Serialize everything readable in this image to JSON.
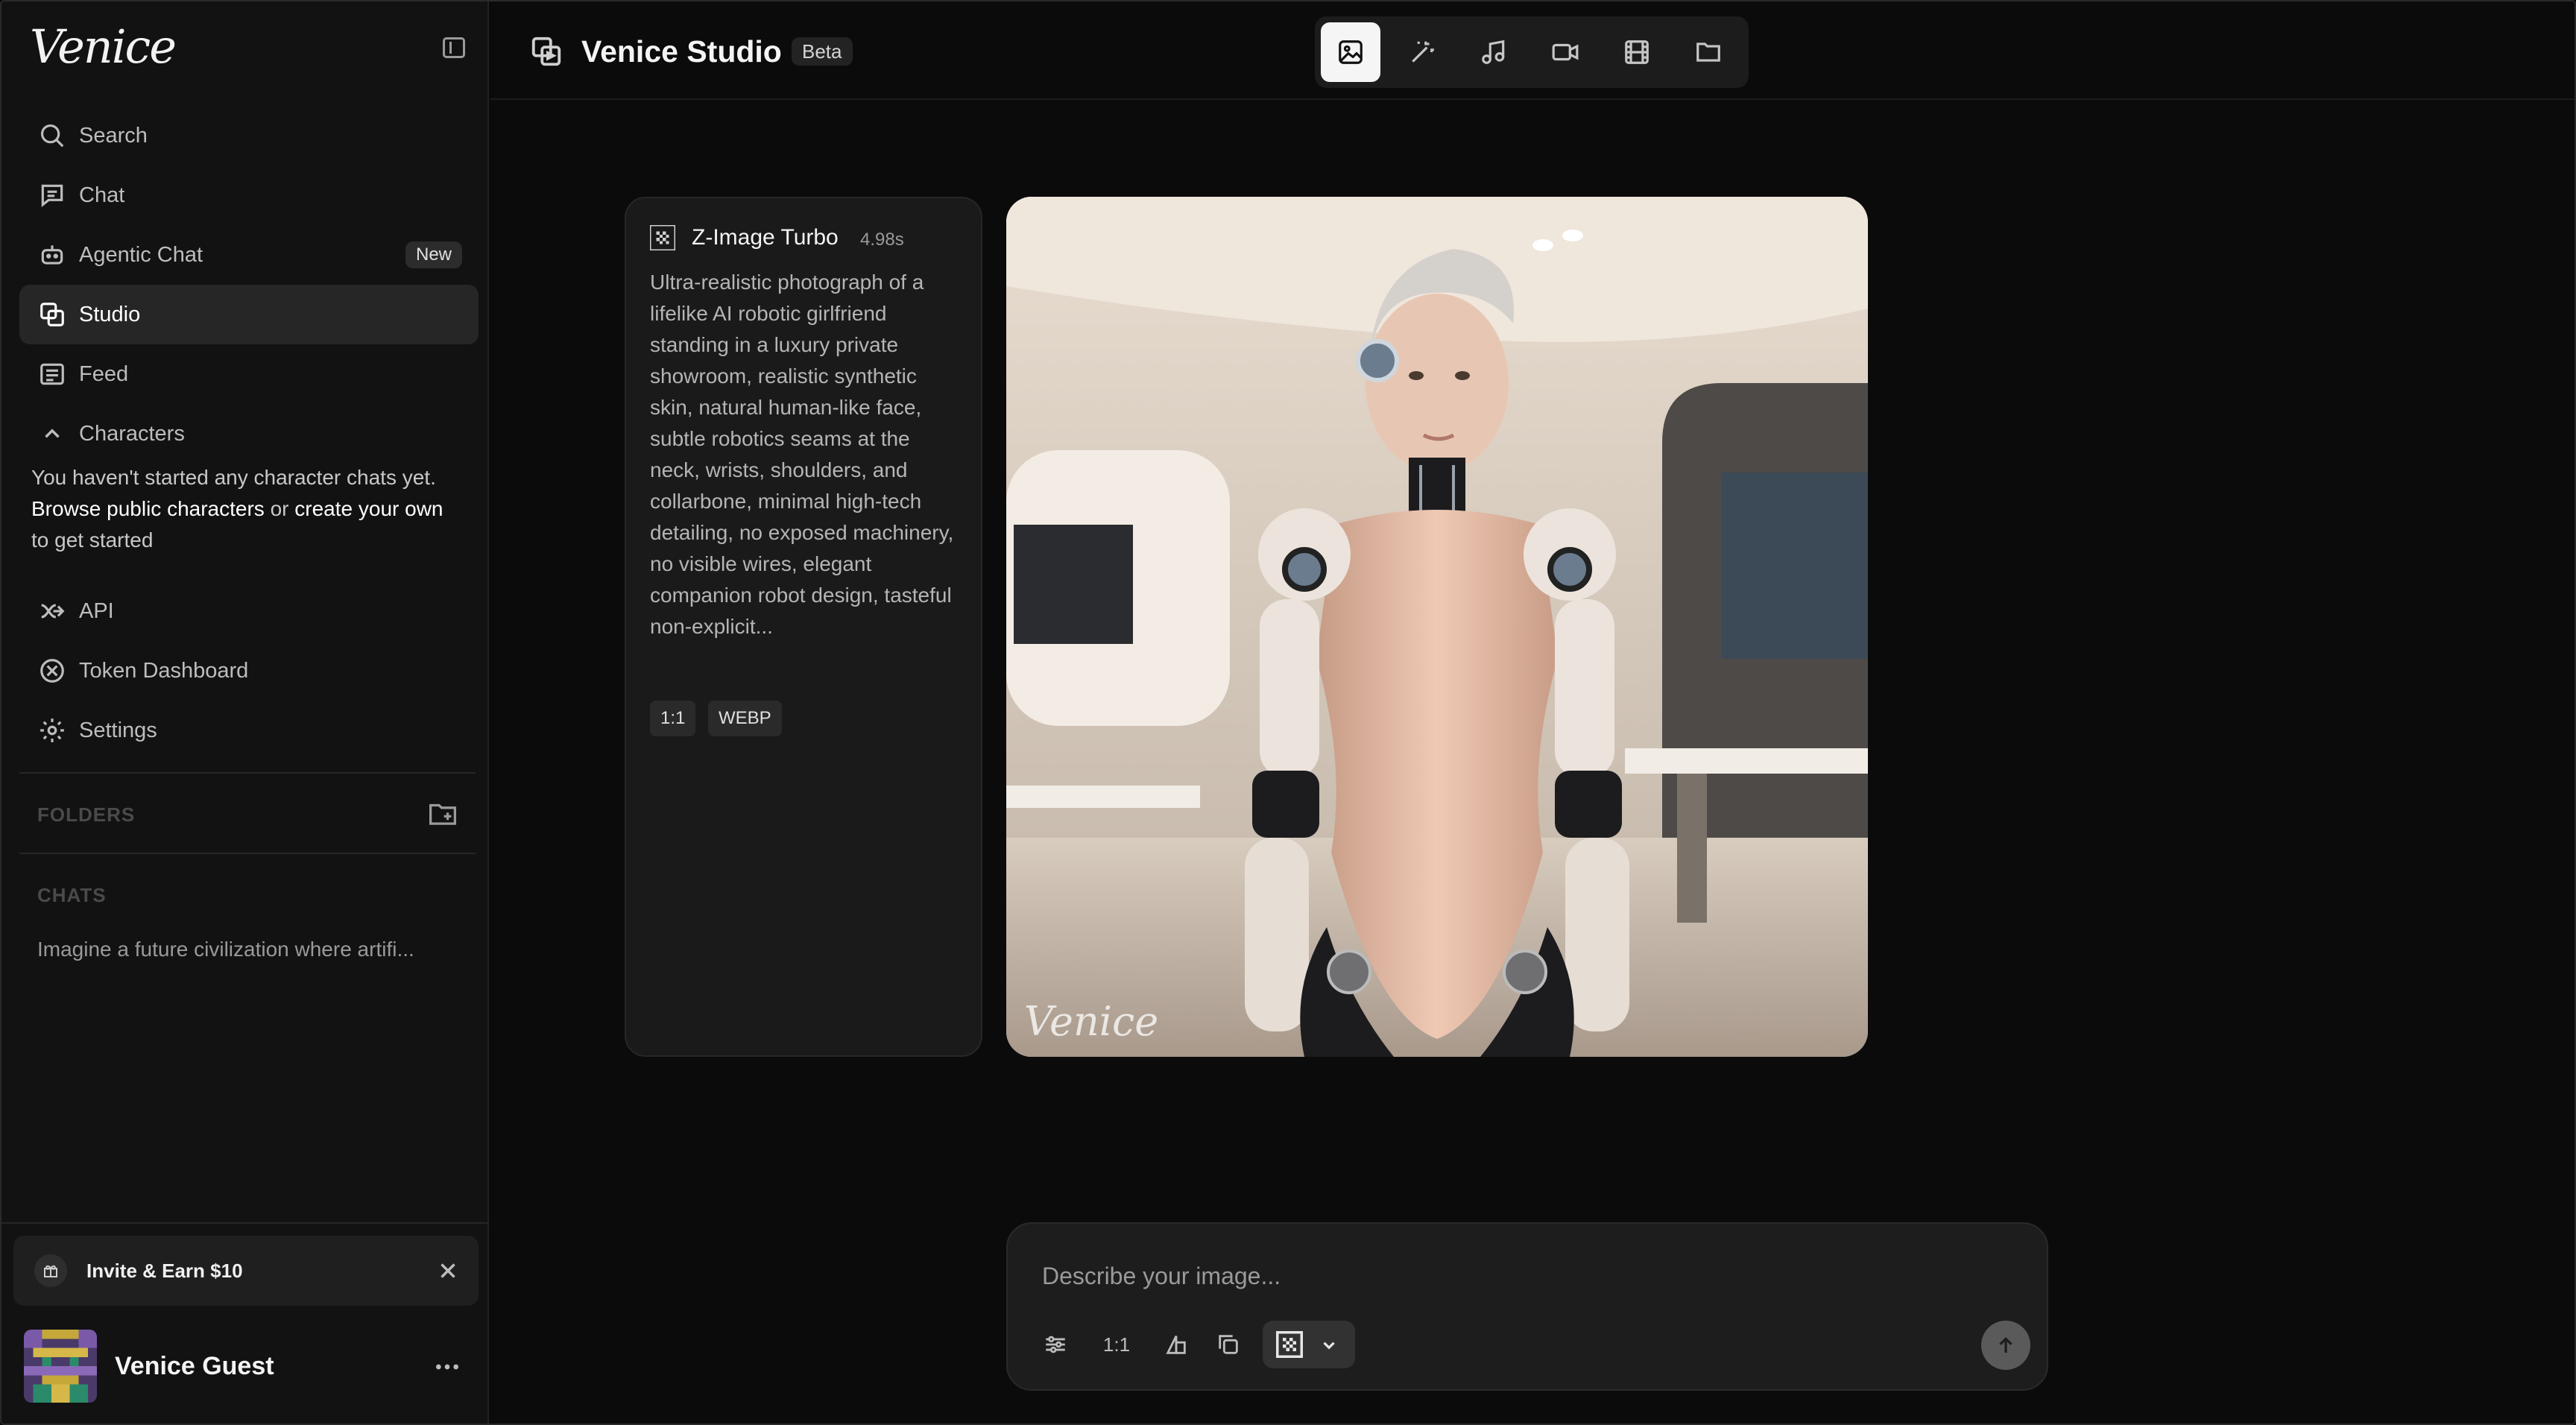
{
  "app": {
    "logo": "Venice"
  },
  "sidebar": {
    "items": [
      {
        "label": "Search",
        "icon": "search-icon"
      },
      {
        "label": "Chat",
        "icon": "chat-icon"
      },
      {
        "label": "Agentic Chat",
        "icon": "robot-icon",
        "badge": "New"
      },
      {
        "label": "Studio",
        "icon": "studio-icon",
        "active": true
      },
      {
        "label": "Feed",
        "icon": "feed-icon"
      },
      {
        "label": "Characters",
        "icon": "chevron-up-icon"
      }
    ],
    "characters_empty": {
      "line1": "You haven't started any character chats yet.",
      "link_browse": "Browse public characters",
      "or_text": " or ",
      "link_create": "create your own",
      "tail": "to get started"
    },
    "secondary_items": [
      {
        "label": "API",
        "icon": "api-icon"
      },
      {
        "label": "Token Dashboard",
        "icon": "token-icon"
      },
      {
        "label": "Settings",
        "icon": "gear-icon"
      }
    ],
    "folders_label": "FOLDERS",
    "chats_label": "CHATS",
    "chat_entries": [
      "Imagine a future civilization where artifi..."
    ],
    "invite_label": "Invite & Earn $10",
    "user_name": "Venice Guest"
  },
  "header": {
    "title": "Venice Studio",
    "badge": "Beta",
    "modes": [
      "image-icon",
      "magic-wand-icon",
      "music-icon",
      "video-icon",
      "film-icon",
      "folder-icon"
    ]
  },
  "generation": {
    "model": "Z-Image Turbo",
    "time": "4.98s",
    "prompt": "Ultra-realistic photograph of a lifelike AI robotic girlfriend standing in a luxury private showroom, realistic synthetic skin, natural human-like face, subtle robotics seams at the neck, wrists, shoulders, and collarbone, minimal high-tech detailing, no exposed machinery, no visible wires, elegant companion robot design, tasteful non-explicit...",
    "tags": [
      "1:1",
      "WEBP"
    ],
    "watermark": "Venice"
  },
  "composer": {
    "placeholder": "Describe your image...",
    "aspect_label": "1:1"
  },
  "colors": {
    "sidebar_bg": "#121212",
    "main_bg": "#0b0b0b",
    "active_item": "#262626"
  }
}
